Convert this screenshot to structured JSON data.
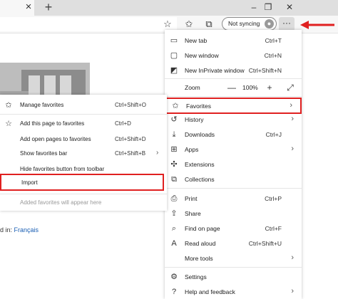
{
  "window": {
    "tab_close": "×",
    "new_tab": "+",
    "minimize": "–",
    "restore": "❐",
    "close": "✕"
  },
  "toolbar": {
    "sync_label": "Not syncing",
    "more_label": "···"
  },
  "page": {
    "lang_prefix": "d in:",
    "lang_link": "Français"
  },
  "main_menu": {
    "new_tab": {
      "label": "New tab",
      "shortcut": "Ctrl+T"
    },
    "new_window": {
      "label": "New window",
      "shortcut": "Ctrl+N"
    },
    "new_inprivate": {
      "label": "New InPrivate window",
      "shortcut": "Ctrl+Shift+N"
    },
    "zoom": {
      "label": "Zoom",
      "minus": "—",
      "value": "100%",
      "plus": "+"
    },
    "favorites": {
      "label": "Favorites"
    },
    "history": {
      "label": "History"
    },
    "downloads": {
      "label": "Downloads",
      "shortcut": "Ctrl+J"
    },
    "apps": {
      "label": "Apps"
    },
    "extensions": {
      "label": "Extensions"
    },
    "collections": {
      "label": "Collections"
    },
    "print": {
      "label": "Print",
      "shortcut": "Ctrl+P"
    },
    "share": {
      "label": "Share"
    },
    "find": {
      "label": "Find on page",
      "shortcut": "Ctrl+F"
    },
    "read_aloud": {
      "label": "Read aloud",
      "shortcut": "Ctrl+Shift+U"
    },
    "more_tools": {
      "label": "More tools"
    },
    "settings": {
      "label": "Settings"
    },
    "help": {
      "label": "Help and feedback"
    }
  },
  "favorites_menu": {
    "manage": {
      "label": "Manage favorites",
      "shortcut": "Ctrl+Shift+O"
    },
    "add_page": {
      "label": "Add this page to favorites",
      "shortcut": "Ctrl+D"
    },
    "add_open": {
      "label": "Add open pages to favorites",
      "shortcut": "Ctrl+Shift+D"
    },
    "show_bar": {
      "label": "Show favorites bar",
      "shortcut": "Ctrl+Shift+B"
    },
    "hide_button": {
      "label": "Hide favorites button from toolbar"
    },
    "import": {
      "label": "Import"
    },
    "empty_note": {
      "label": "Added favorites will appear here"
    }
  },
  "colors": {
    "highlight": "#e02020",
    "link": "#1a5fb4"
  }
}
